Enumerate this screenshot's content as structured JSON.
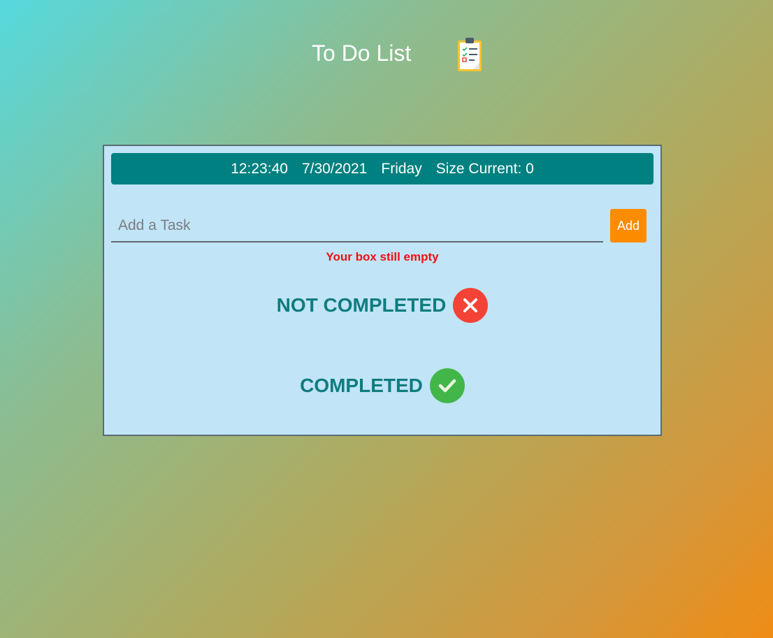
{
  "app": {
    "title": "To Do List",
    "icon": "clipboard-checklist-icon"
  },
  "status_bar": {
    "time": "12:23:40",
    "date": "7/30/2021",
    "day": "Friday",
    "size_label": "Size Current: 0"
  },
  "task_form": {
    "input_value": "",
    "input_placeholder": "Add a Task",
    "add_label": "Add",
    "error_message": "Your box still empty"
  },
  "sections": {
    "not_completed": {
      "label": "NOT COMPLETED",
      "icon": "x-circle-icon",
      "color": "#f44336"
    },
    "completed": {
      "label": "COMPLETED",
      "icon": "check-circle-icon",
      "color": "#43b649"
    }
  },
  "colors": {
    "status_bar": "#008080",
    "add_button": "#fb8c00",
    "panel": "#c1e4f7",
    "heading": "#0e7d7d",
    "error": "#ee1111"
  }
}
